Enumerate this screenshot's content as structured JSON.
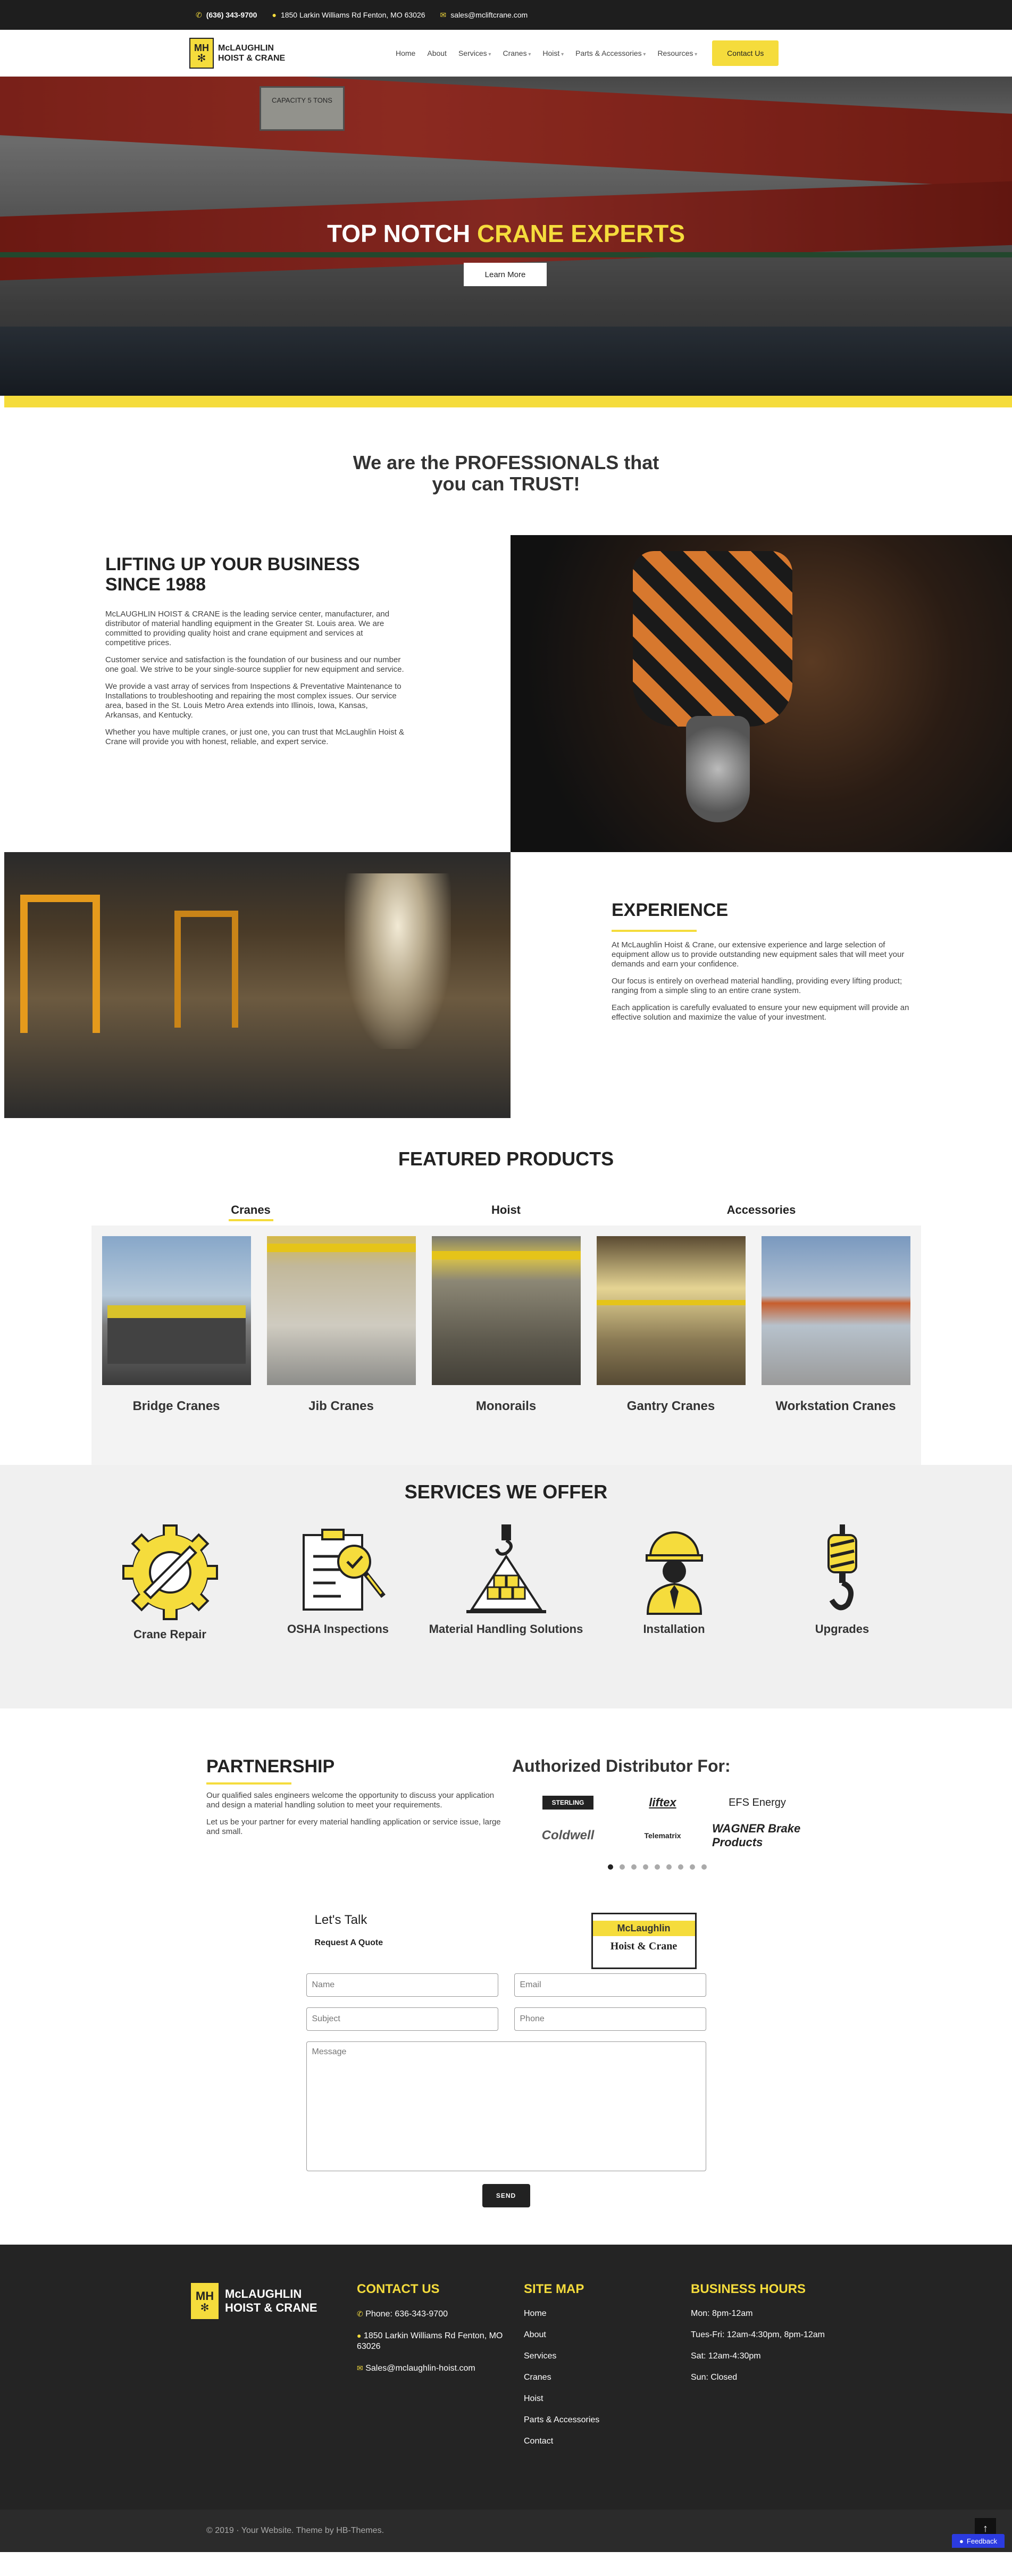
{
  "topbar": {
    "phone": "(636) 343-9700",
    "address": "1850 Larkin Williams Rd Fenton, MO 63026",
    "email": "sales@mcliftcrane.com"
  },
  "brand": {
    "mark": "MH",
    "line1": "McLAUGHLIN",
    "line2": "HOIST & CRANE"
  },
  "nav": {
    "items": [
      "Home",
      "About",
      "Services",
      "Cranes",
      "Hoist",
      "Parts & Accessories",
      "Resources"
    ],
    "contact": "Contact Us"
  },
  "hero": {
    "sign": "CAPACITY 5 TONS",
    "title_white": "TOP NOTCH",
    "title_yellow": "CRANE EXPERTS",
    "button": "Learn More"
  },
  "intro": {
    "line1": "We are the PROFESSIONALS that",
    "line2": "you can TRUST!"
  },
  "about": {
    "title": "LIFTING UP YOUR BUSINESS SINCE 1988",
    "p1": "McLAUGHLIN HOIST & CRANE is the leading service center, manufacturer, and distributor of material handling equipment in the Greater St. Louis area. We are committed to providing quality hoist and crane equipment and services at competitive prices.",
    "p2": "Customer service and satisfaction is the foundation of our business and our number one goal. We strive to be your single-source supplier for new equipment and service.",
    "p3": "We provide a vast array of services from Inspections & Preventative Maintenance to Installations to troubleshooting and repairing the most complex issues. Our service area, based in the St. Louis Metro Area extends into Illinois, Iowa, Kansas, Arkansas, and Kentucky.",
    "p4": "Whether you have multiple cranes, or just one, you can trust that McLaughlin Hoist & Crane will provide you with honest, reliable, and expert service."
  },
  "experience": {
    "title": "EXPERIENCE",
    "p1": "At McLaughlin Hoist & Crane, our extensive experience and large selection of equipment allow us to provide outstanding new equipment sales that will meet your demands and earn your confidence.",
    "p2": "Our focus is entirely on overhead material handling, providing every lifting product; ranging from a simple sling to an entire crane system.",
    "p3": "Each application is carefully evaluated to ensure your new equipment will provide an effective solution and maximize the value of your investment."
  },
  "featured": {
    "title": "FEATURED PRODUCTS",
    "tabs": [
      "Cranes",
      "Hoist",
      "Accessories"
    ],
    "products": [
      "Bridge Cranes",
      "Jib Cranes",
      "Monorails",
      "Gantry Cranes",
      "Workstation Cranes"
    ]
  },
  "services": {
    "title": "SERVICES WE OFFER",
    "items": [
      "Crane Repair",
      "OSHA Inspections",
      "Material Handling Solutions",
      "Installation",
      "Upgrades"
    ]
  },
  "partnership": {
    "title": "PARTNERSHIP",
    "p1": "Our qualified sales engineers welcome the opportunity to discuss your application and design a material handling solution to meet your requirements.",
    "p2": "Let us be your partner for every material handling application or service issue, large and small.",
    "distributor_title": "Authorized Distributor For:",
    "logos": [
      "STERLING",
      "liftex",
      "EFS Energy",
      "Coldwell",
      "Telematrix",
      "WAGNER Brake Products"
    ]
  },
  "contact": {
    "title": "Let's Talk",
    "subtitle": "Request A Quote",
    "badge_top": "McLaughlin",
    "badge_bottom": "Hoist & Crane",
    "name_ph": "Name",
    "email_ph": "Email",
    "subject_ph": "Subject",
    "phone_ph": "Phone",
    "message_ph": "Message",
    "send": "SEND"
  },
  "footer": {
    "contact_title": "CONTACT US",
    "phone": "Phone: 636-343-9700",
    "address": "1850 Larkin Williams Rd Fenton, MO 63026",
    "email": "Sales@mclaughlin-hoist.com",
    "sitemap_title": "SITE MAP",
    "sitemap": [
      "Home",
      "About",
      "Services",
      "Cranes",
      "Hoist",
      "Parts & Accessories",
      "Contact"
    ],
    "hours_title": "BUSINESS HOURS",
    "hours": [
      "Mon: 8pm-12am",
      "Tues-Fri: 12am-4:30pm, 8pm-12am",
      "Sat: 12am-4:30pm",
      "Sun: Closed"
    ],
    "copyright": "© 2019 · Your Website. Theme by HB-Themes.",
    "feedback": "Feedback"
  },
  "colors": {
    "accent": "#f5dc3c",
    "dark": "#242424"
  }
}
